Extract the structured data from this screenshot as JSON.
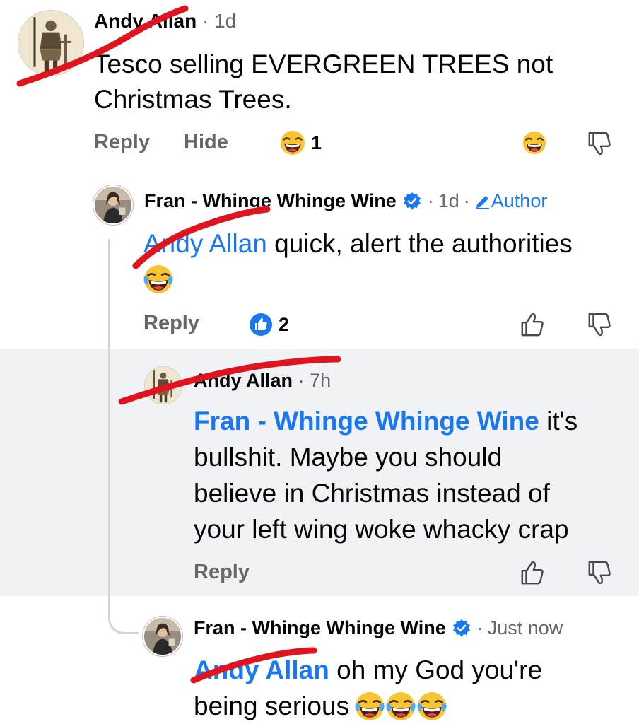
{
  "comments": [
    {
      "author": "Andy Allan",
      "time": "1d",
      "text": "Tesco selling EVERGREEN TREES not Christmas Trees.",
      "text_line1": "Tesco selling EVERGREEN TREES not",
      "text_line2": "Christmas Trees.",
      "actions": {
        "reply": "Reply",
        "hide": "Hide"
      },
      "reaction": {
        "icon": "laughing-emoji-icon",
        "count": "1"
      }
    },
    {
      "author": "Fran - Whinge Whinge Wine",
      "verified": true,
      "time": "1d",
      "badge": "Author",
      "mention": "Andy Allan",
      "text": " quick, alert the authorities",
      "actions": {
        "reply": "Reply"
      },
      "reaction": {
        "icon": "like-icon",
        "count": "2"
      }
    },
    {
      "author": "Andy Allan",
      "time": "7h",
      "mention": "Fran - Whinge Whinge Wine",
      "text_line1_rest": " it's",
      "text_line2": "bullshit.  Maybe you should",
      "text_line3": "believe in Christmas instead of",
      "text_line4": "your left wing woke whacky crap",
      "actions": {
        "reply": "Reply"
      }
    },
    {
      "author": "Fran - Whinge Whinge Wine",
      "verified": true,
      "time": "Just now",
      "mention": "Andy Allan",
      "text_line1_rest": " oh my God you're",
      "text_line2": "being serious"
    }
  ],
  "separator": "·",
  "colors": {
    "mention": "#1877f2",
    "highlight_bg": "#f0f2f5",
    "red_scribble": "#e0141e",
    "meta_text": "#65676b"
  }
}
